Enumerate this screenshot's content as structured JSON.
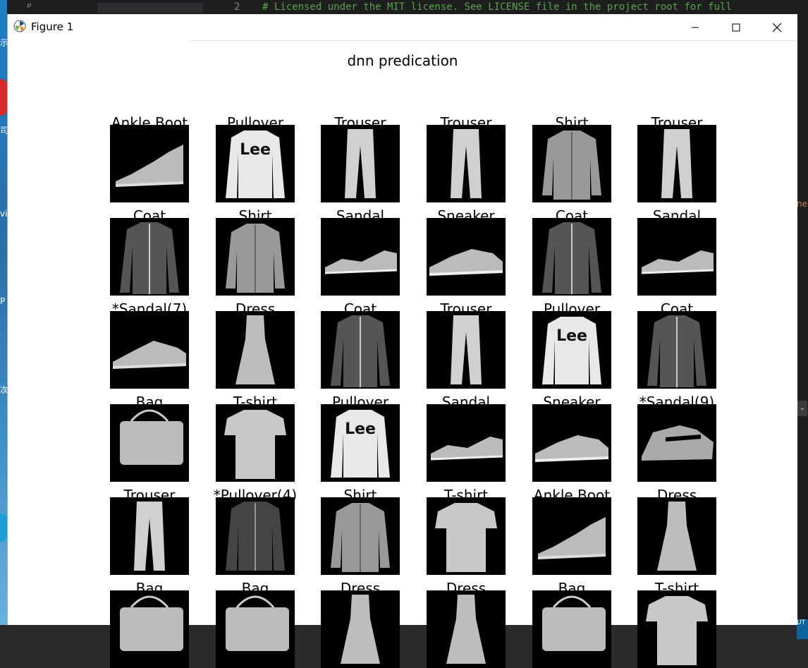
{
  "editor": {
    "line_number": "2",
    "code_line": "# Licensed under the MIT license.  See LICENSE file in the project root for full"
  },
  "window": {
    "title": "Figure 1",
    "icons": {
      "app": "matplotlib-icon",
      "minimize": "minimize-icon",
      "maximize": "maximize-icon",
      "close": "close-icon"
    }
  },
  "figure": {
    "title": "dnn predication",
    "rows": [
      [
        "Ankle Boot",
        "Pullover",
        "Trouser",
        "Trouser",
        "Shirt",
        "Trouser"
      ],
      [
        "Coat",
        "Shirt",
        "Sandal",
        "Sneaker",
        "Coat",
        "Sandal"
      ],
      [
        "*Sandal(7)",
        "Dress",
        "Coat",
        "Trouser",
        "Pullover",
        "Coat"
      ],
      [
        "Bag",
        "T-shirt",
        "Pullover",
        "Sandal",
        "Sneaker",
        "*Sandal(9)"
      ],
      [
        "Trouser",
        "*Pullover(4)",
        "Shirt",
        "T-shirt",
        "Ankle Boot",
        "Dress"
      ],
      [
        "Bag",
        "Bag",
        "Dress",
        "Dress",
        "Bag",
        "T-shirt"
      ]
    ]
  }
}
